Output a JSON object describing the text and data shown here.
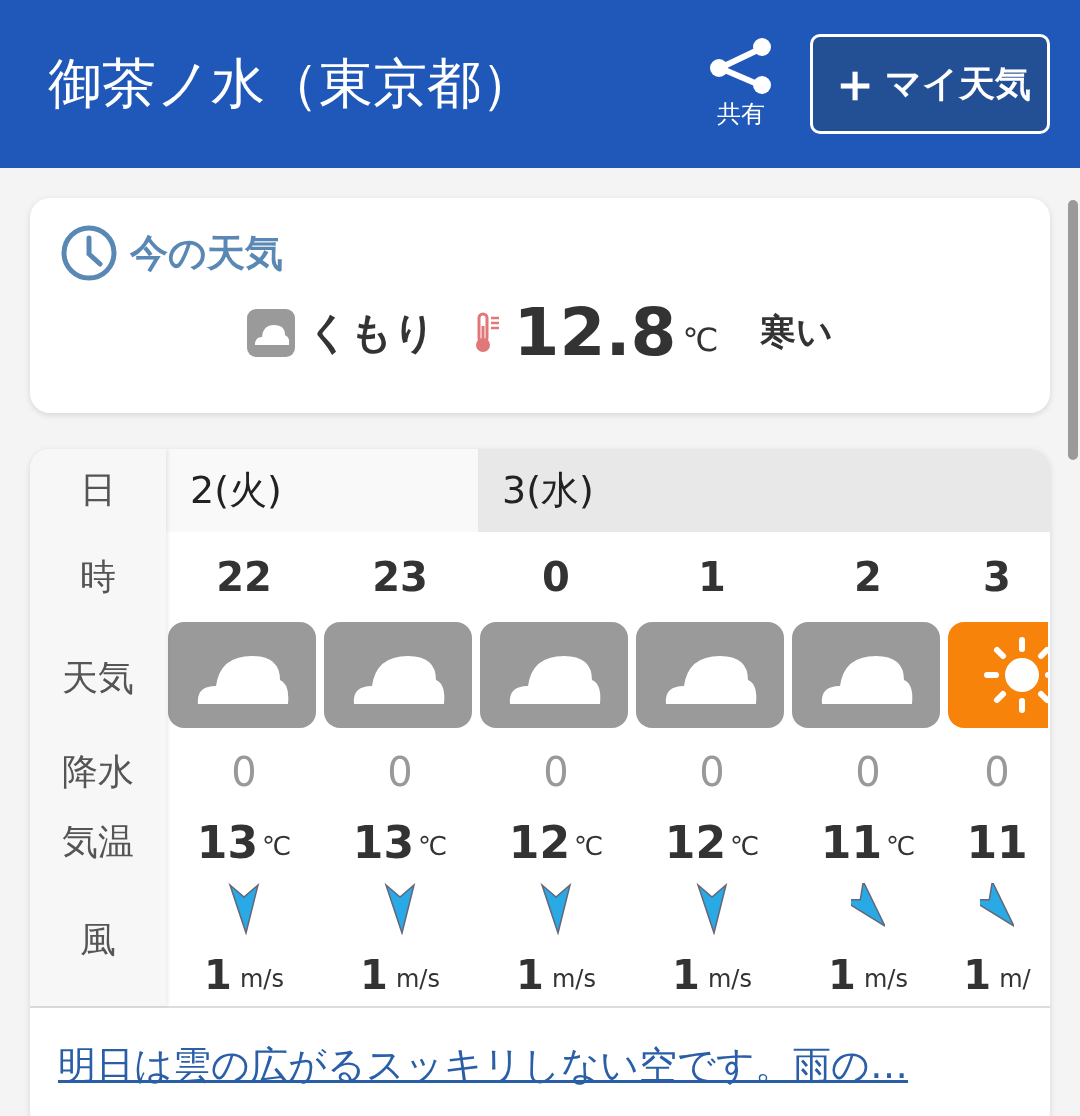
{
  "header": {
    "title": "御茶ノ水（東京都）",
    "share_label": "共有",
    "my_weather_button": {
      "plus": "＋",
      "label": "マイ天気"
    }
  },
  "now": {
    "heading": "今の天気",
    "weather": {
      "kind": "cloudy",
      "label": "くもり"
    },
    "temperature": "12.8",
    "unit": "℃",
    "feeling": "寒い"
  },
  "hourly": {
    "labels": {
      "day": "日",
      "hour": "時",
      "weather": "天気",
      "precipitation": "降水",
      "temperature": "気温",
      "wind": "風"
    },
    "days": [
      {
        "label": "2(火)",
        "selected": true,
        "hours": [
          {
            "hour": "22",
            "weather": {
              "kind": "cloudy"
            },
            "precipitation": "0",
            "temperature": "13",
            "unit": "℃",
            "wind": {
              "kind": "north",
              "speed": "1",
              "unit": "m/s"
            }
          },
          {
            "hour": "23",
            "weather": {
              "kind": "cloudy"
            },
            "precipitation": "0",
            "temperature": "13",
            "unit": "℃",
            "wind": {
              "kind": "north",
              "speed": "1",
              "unit": "m/s"
            }
          }
        ]
      },
      {
        "label": "3(水)",
        "selected": false,
        "hours": [
          {
            "hour": "0",
            "weather": {
              "kind": "cloudy"
            },
            "precipitation": "0",
            "temperature": "12",
            "unit": "℃",
            "wind": {
              "kind": "north",
              "speed": "1",
              "unit": "m/s"
            }
          },
          {
            "hour": "1",
            "weather": {
              "kind": "cloudy"
            },
            "precipitation": "0",
            "temperature": "12",
            "unit": "℃",
            "wind": {
              "kind": "north",
              "speed": "1",
              "unit": "m/s"
            }
          },
          {
            "hour": "2",
            "weather": {
              "kind": "cloudy"
            },
            "precipitation": "0",
            "temperature": "11",
            "unit": "℃",
            "wind": {
              "kind": "northwest",
              "speed": "1",
              "unit": "m/s"
            }
          },
          {
            "hour": "3",
            "weather": {
              "kind": "sunny"
            },
            "precipitation": "0",
            "temperature": "11",
            "wind": {
              "kind": "northwest",
              "speed": "1",
              "unit": "m/"
            }
          }
        ]
      }
    ]
  },
  "forecast_link": "明日は雲の広がるスッキリしない空です。雨の…"
}
